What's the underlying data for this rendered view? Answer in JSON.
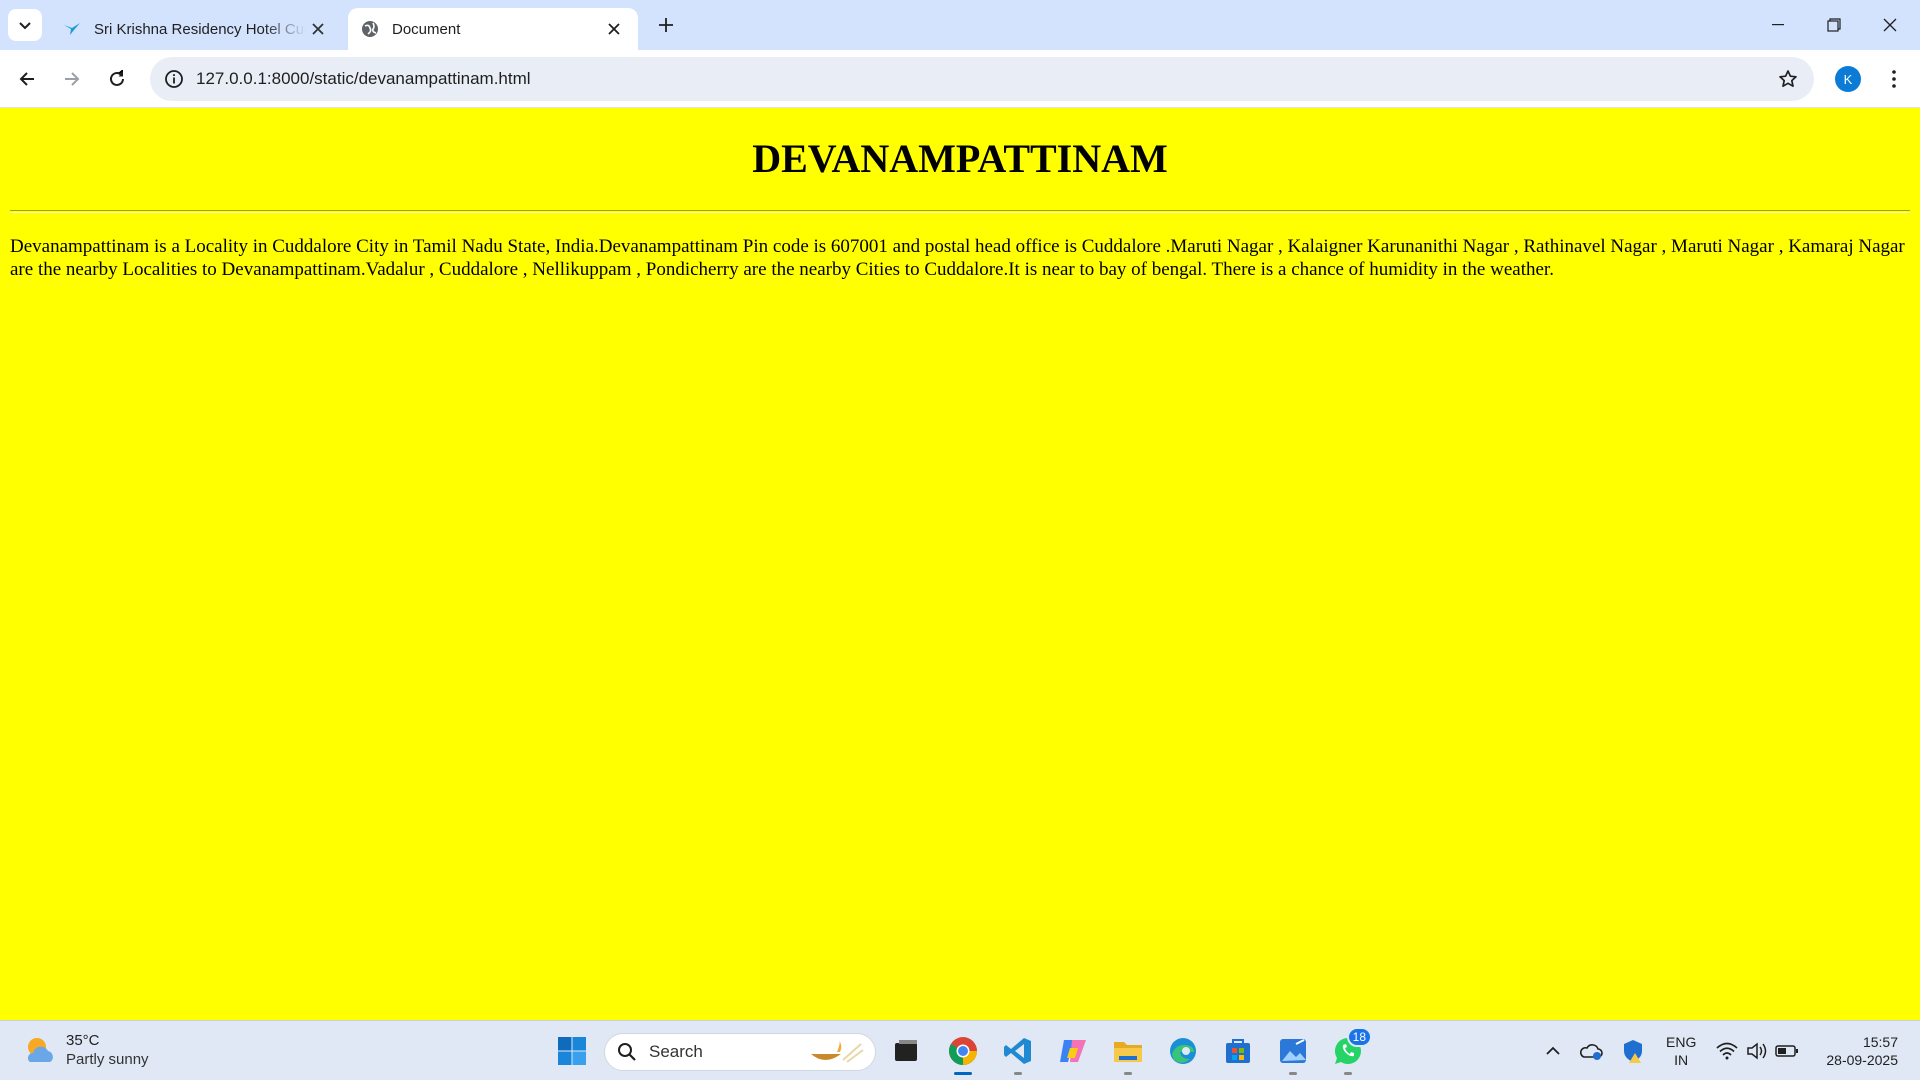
{
  "browser": {
    "tabs": [
      {
        "title": "Sri Krishna Residency Hotel Cuddalore",
        "active": false
      },
      {
        "title": "Document",
        "active": true
      }
    ],
    "url": "127.0.0.1:8000/static/devanampattinam.html",
    "profile_initial": "K"
  },
  "page": {
    "background_color": "#ffff00",
    "heading": "DEVANAMPATTINAM",
    "paragraph": "Devanampattinam is a Locality in Cuddalore City in Tamil Nadu State, India.Devanampattinam Pin code is 607001 and postal head office is Cuddalore .Maruti Nagar , Kalaigner Karunanithi Nagar , Rathinavel Nagar , Maruti Nagar , Kamaraj Nagar are the nearby Localities to Devanampattinam.Vadalur , Cuddalore , Nellikuppam , Pondicherry are the nearby Cities to Cuddalore.It is near to bay of bengal. There is a chance of humidity in the weather."
  },
  "taskbar": {
    "weather": {
      "temp": "35°C",
      "condition": "Partly sunny"
    },
    "search_label": "Search",
    "whatsapp_badge": "18",
    "apps": [
      "windows-start",
      "search",
      "task-view",
      "chrome",
      "vscode",
      "copilot",
      "file-explorer",
      "edge",
      "microsoft-store",
      "photos",
      "whatsapp"
    ],
    "language": {
      "line1": "ENG",
      "line2": "IN"
    },
    "clock": {
      "time": "15:57",
      "date": "28-09-2025"
    }
  }
}
